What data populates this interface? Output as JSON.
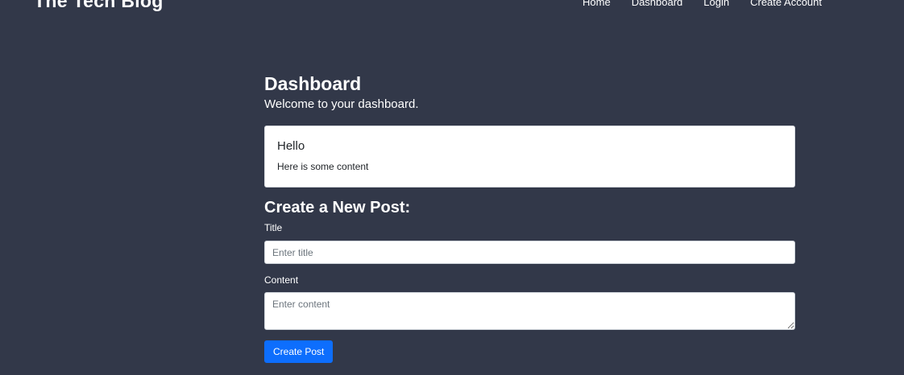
{
  "navbar": {
    "brand": "The Tech Blog",
    "links": [
      {
        "label": "Home"
      },
      {
        "label": "Dashboard"
      },
      {
        "label": "Login"
      },
      {
        "label": "Create Account"
      }
    ]
  },
  "dashboard": {
    "title": "Dashboard",
    "subtitle": "Welcome to your dashboard."
  },
  "posts": [
    {
      "title": "Hello",
      "content": "Here is some content"
    }
  ],
  "new_post_form": {
    "heading": "Create a New Post:",
    "title_label": "Title",
    "title_placeholder": "Enter title",
    "title_value": "",
    "content_label": "Content",
    "content_placeholder": "Enter content",
    "content_value": "",
    "submit_label": "Create Post"
  },
  "colors": {
    "background": "#323849",
    "primary_button": "#0d6efd",
    "card_background": "#ffffff"
  }
}
